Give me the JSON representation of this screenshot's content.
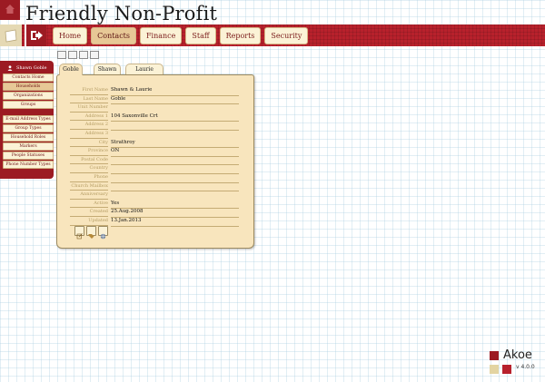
{
  "header": {
    "title": "Friendly Non-Profit",
    "nav": [
      {
        "label": "Home",
        "active": false
      },
      {
        "label": "Contacts",
        "active": true
      },
      {
        "label": "Finance",
        "active": false
      },
      {
        "label": "Staff",
        "active": false
      },
      {
        "label": "Reports",
        "active": false
      },
      {
        "label": "Security",
        "active": false
      }
    ],
    "colors": {
      "brand_red": "#b8212c",
      "dark_red": "#9c1b23",
      "cream": "#fbf2d6",
      "tan": "#e7c896"
    }
  },
  "sidebar": {
    "user_label": "Shawn Goble",
    "items": [
      {
        "label": "Contacts Home",
        "selected": false
      },
      {
        "label": "Households",
        "selected": true
      },
      {
        "label": "Organizations",
        "selected": false
      },
      {
        "label": "Groups",
        "selected": false
      },
      {
        "label": "E-mail Address Types",
        "selected": false
      },
      {
        "label": "Group Types",
        "selected": false
      },
      {
        "label": "Household Roles",
        "selected": false
      },
      {
        "label": "Markers",
        "selected": false
      },
      {
        "label": "People Statuses",
        "selected": false
      },
      {
        "label": "Phone Number Types",
        "selected": false
      }
    ]
  },
  "panel": {
    "tabs": [
      {
        "label": "Goble",
        "active": true
      },
      {
        "label": "Shawn",
        "active": false
      },
      {
        "label": "Laurie",
        "active": false
      }
    ],
    "fields": [
      {
        "label": "First Name",
        "value": "Shawn & Laurie"
      },
      {
        "label": "Last Name",
        "value": "Goble"
      },
      {
        "label": "Unit Number",
        "value": ""
      },
      {
        "label": "Address 1",
        "value": "104 Saxonville Crt"
      },
      {
        "label": "Address 2",
        "value": ""
      },
      {
        "label": "Address 3",
        "value": ""
      },
      {
        "label": "City",
        "value": "Strathroy"
      },
      {
        "label": "Province",
        "value": "ON"
      },
      {
        "label": "Postal Code",
        "value": ""
      },
      {
        "label": "Country",
        "value": ""
      },
      {
        "label": "Phone",
        "value": ""
      },
      {
        "label": "Church Mailbox",
        "value": ""
      },
      {
        "label": "Anniversary",
        "value": ""
      },
      {
        "label": "Active",
        "value": "Yes"
      },
      {
        "label": "Created",
        "value": "25.Aug.2008"
      },
      {
        "label": "Updated",
        "value": "13.Jan.2013"
      }
    ],
    "actions": [
      "edit-icon",
      "tags-icon",
      "globe-icon"
    ]
  },
  "brand": {
    "name": "Akoe",
    "version": "v 4.0.0"
  }
}
